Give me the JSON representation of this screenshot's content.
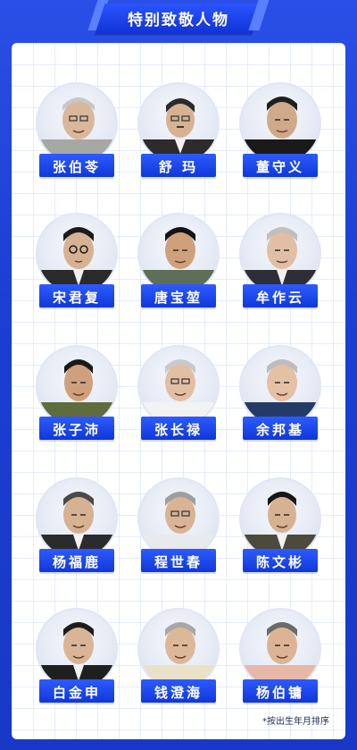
{
  "header": {
    "title": "特别致敬人物"
  },
  "people": [
    {
      "name": "张伯苓",
      "icon": "portrait-icon"
    },
    {
      "name": "舒 玛",
      "icon": "portrait-icon"
    },
    {
      "name": "董守义",
      "icon": "portrait-icon"
    },
    {
      "name": "宋君复",
      "icon": "portrait-icon"
    },
    {
      "name": "唐宝堃",
      "icon": "portrait-icon"
    },
    {
      "name": "牟作云",
      "icon": "portrait-icon"
    },
    {
      "name": "张子沛",
      "icon": "portrait-icon"
    },
    {
      "name": "张长禄",
      "icon": "portrait-icon"
    },
    {
      "name": "余邦基",
      "icon": "portrait-icon"
    },
    {
      "name": "杨福鹿",
      "icon": "portrait-icon"
    },
    {
      "name": "程世春",
      "icon": "portrait-icon"
    },
    {
      "name": "陈文彬",
      "icon": "portrait-icon"
    },
    {
      "name": "白金申",
      "icon": "portrait-icon"
    },
    {
      "name": "钱澄海",
      "icon": "portrait-icon"
    },
    {
      "name": "杨伯镛",
      "icon": "portrait-icon"
    }
  ],
  "footer": {
    "note": "*按出生年月排序"
  },
  "colors": {
    "background": "#1f40d8",
    "nameplate": "#1038d8",
    "card": "#ffffff"
  }
}
